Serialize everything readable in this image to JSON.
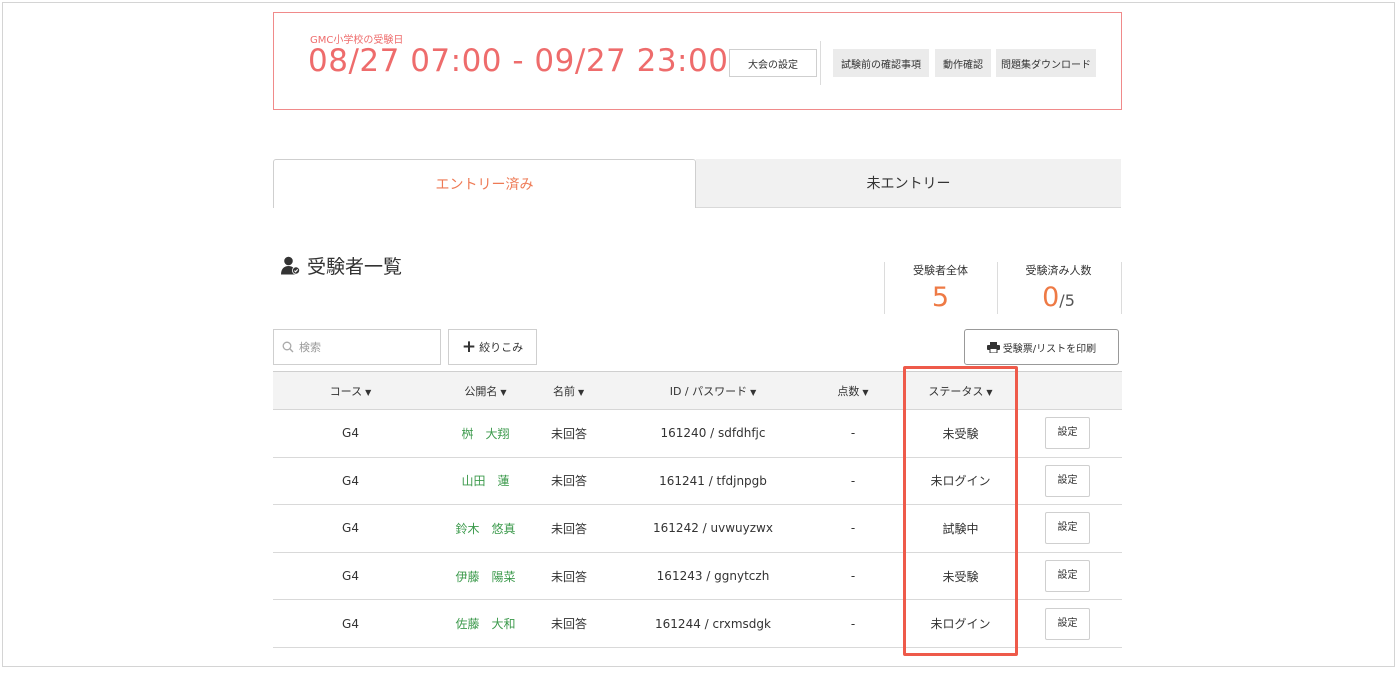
{
  "exam": {
    "school_label": "GMC小学校の受験日",
    "date_range": "08/27 07:00 - 09/27 23:00",
    "settings_button": "大会の設定",
    "actions": [
      "試験前の確認事項",
      "動作確認",
      "問題集ダウンロード"
    ]
  },
  "tabs": [
    {
      "label": "エントリー済み",
      "active": true
    },
    {
      "label": "未エントリー",
      "active": false
    }
  ],
  "section": {
    "title": "受験者一覧"
  },
  "stats": {
    "total_label": "受験者全体",
    "total_value": "5",
    "done_label": "受験済み人数",
    "done_value": "0",
    "done_suffix": "/5"
  },
  "toolbar": {
    "search_placeholder": "検索",
    "filter_label": "絞りこみ",
    "print_label": "受験票/リストを印刷"
  },
  "table": {
    "headers": [
      "コース",
      "公開名",
      "名前",
      "ID / パスワード",
      "点数",
      "ステータス"
    ],
    "rows": [
      {
        "course": "G4",
        "public_name": "桝　大翔",
        "name": "未回答",
        "id_password": "161240 / sdfdhfjc",
        "score": "-",
        "status": "未受験",
        "action": "設定"
      },
      {
        "course": "G4",
        "public_name": "山田　蓮",
        "name": "未回答",
        "id_password": "161241 / tfdjnpgb",
        "score": "-",
        "status": "未ログイン",
        "action": "設定"
      },
      {
        "course": "G4",
        "public_name": "鈴木　悠真",
        "name": "未回答",
        "id_password": "161242 / uvwuyzwx",
        "score": "-",
        "status": "試験中",
        "action": "設定"
      },
      {
        "course": "G4",
        "public_name": "伊藤　陽菜",
        "name": "未回答",
        "id_password": "161243 / ggnytczh",
        "score": "-",
        "status": "未受験",
        "action": "設定"
      },
      {
        "course": "G4",
        "public_name": "佐藤　大和",
        "name": "未回答",
        "id_password": "161244 / crxmsdgk",
        "score": "-",
        "status": "未ログイン",
        "action": "設定"
      }
    ]
  },
  "colors": {
    "accent": "#ee6c6c",
    "orange": "#ee7a45",
    "name_green": "#3c9a4c",
    "highlight": "#ee5a4a"
  }
}
